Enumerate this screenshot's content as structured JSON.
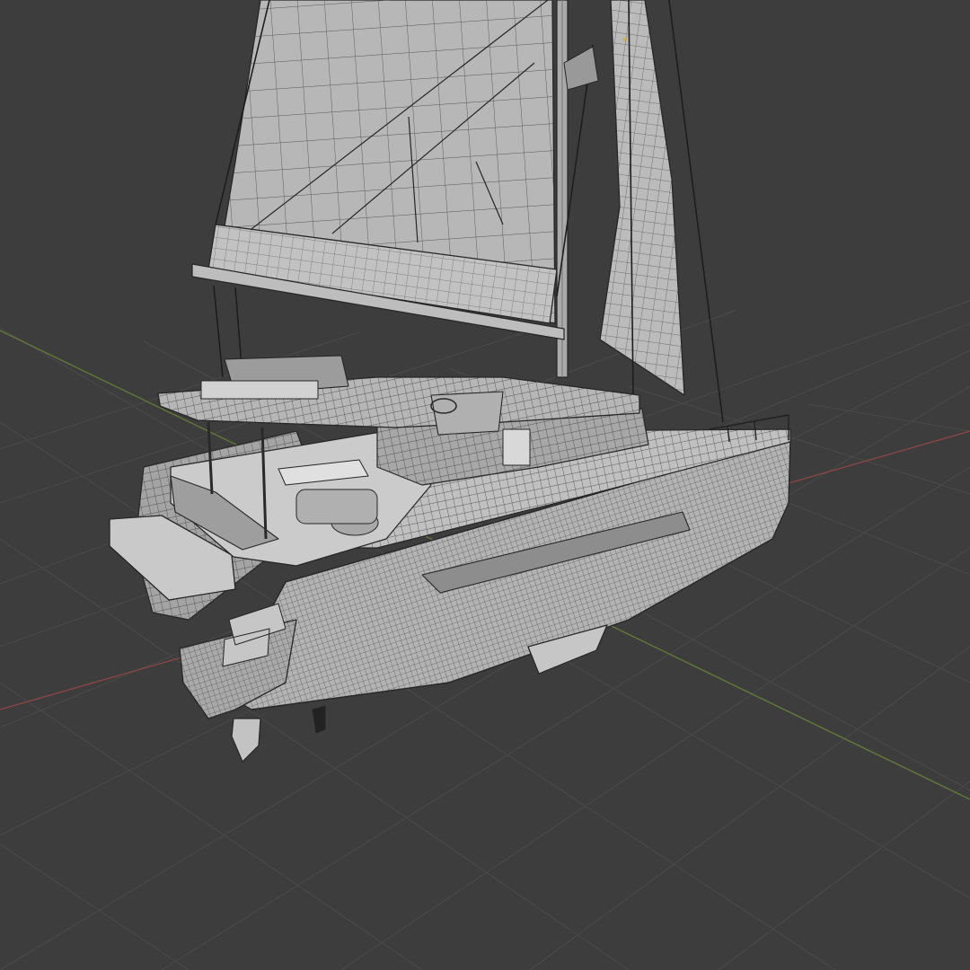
{
  "viewport": {
    "background": "#3d3d3d",
    "grid_color": "#4a4a4a",
    "axis_x_color": "#9c4a4a",
    "axis_y_color": "#6f8a3c",
    "model_fill": "#b8b8b8",
    "model_shadow": "#8f8f8f",
    "wire_color": "#2a2a2a"
  }
}
